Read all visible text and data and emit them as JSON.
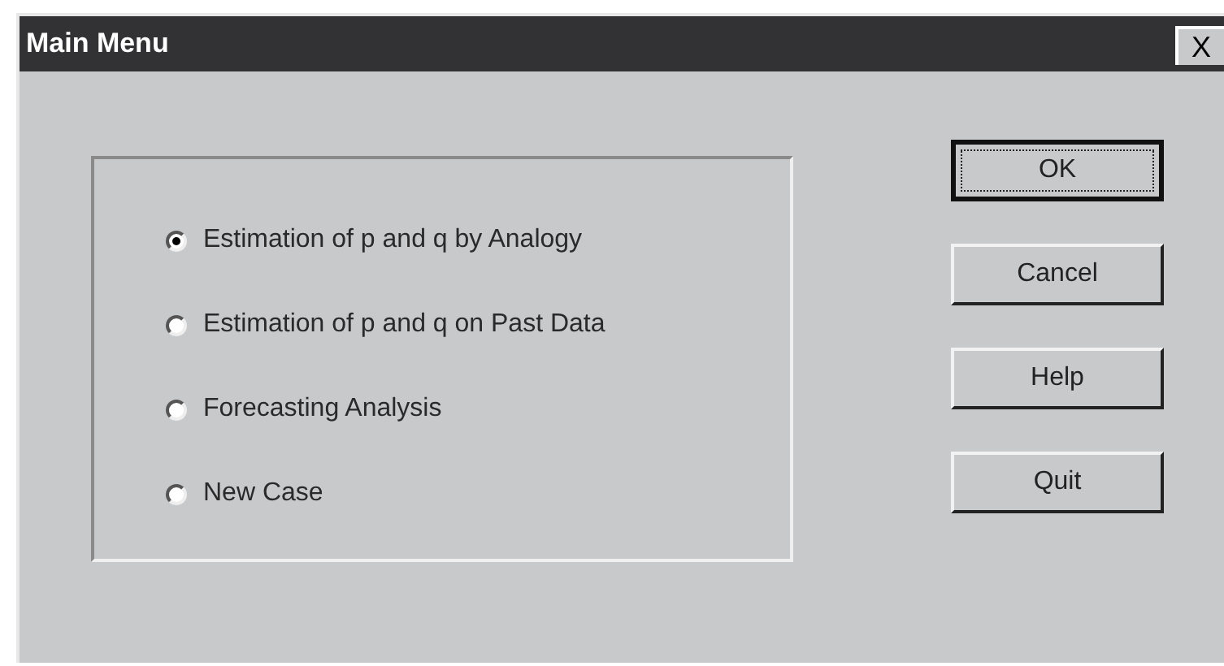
{
  "window": {
    "title": "Main Menu",
    "close": "X"
  },
  "options": [
    {
      "label": "Estimation of p and q by Analogy",
      "selected": true
    },
    {
      "label": "Estimation of p and q on Past Data",
      "selected": false
    },
    {
      "label": "Forecasting Analysis",
      "selected": false
    },
    {
      "label": "New Case",
      "selected": false
    }
  ],
  "buttons": [
    {
      "label": "OK",
      "default": true
    },
    {
      "label": "Cancel",
      "default": false
    },
    {
      "label": "Help",
      "default": false
    },
    {
      "label": "Quit",
      "default": false
    }
  ]
}
